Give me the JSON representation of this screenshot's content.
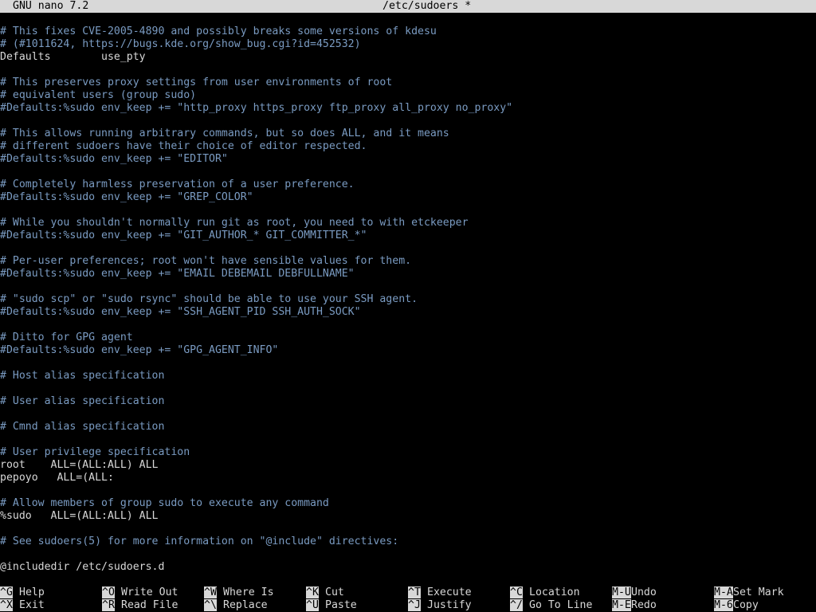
{
  "titlebar": {
    "version": "GNU nano 7.2",
    "filename": "/etc/sudoers *"
  },
  "colors": {
    "background": "#000000",
    "text": "#d8d8d8",
    "comment": "#7a9bc2",
    "inverse_bg": "#d8d8d8"
  },
  "buffer": {
    "lines": [
      {
        "text": "# This fixes CVE-2005-4890 and possibly breaks some versions of kdesu",
        "comment": true
      },
      {
        "text": "# (#1011624, https://bugs.kde.org/show_bug.cgi?id=452532)",
        "comment": true
      },
      {
        "text": "Defaults        use_pty",
        "comment": false
      },
      {
        "text": "",
        "comment": false
      },
      {
        "text": "# This preserves proxy settings from user environments of root",
        "comment": true
      },
      {
        "text": "# equivalent users (group sudo)",
        "comment": true
      },
      {
        "text": "#Defaults:%sudo env_keep += \"http_proxy https_proxy ftp_proxy all_proxy no_proxy\"",
        "comment": true
      },
      {
        "text": "",
        "comment": false
      },
      {
        "text": "# This allows running arbitrary commands, but so does ALL, and it means",
        "comment": true
      },
      {
        "text": "# different sudoers have their choice of editor respected.",
        "comment": true
      },
      {
        "text": "#Defaults:%sudo env_keep += \"EDITOR\"",
        "comment": true
      },
      {
        "text": "",
        "comment": false
      },
      {
        "text": "# Completely harmless preservation of a user preference.",
        "comment": true
      },
      {
        "text": "#Defaults:%sudo env_keep += \"GREP_COLOR\"",
        "comment": true
      },
      {
        "text": "",
        "comment": false
      },
      {
        "text": "# While you shouldn't normally run git as root, you need to with etckeeper",
        "comment": true
      },
      {
        "text": "#Defaults:%sudo env_keep += \"GIT_AUTHOR_* GIT_COMMITTER_*\"",
        "comment": true
      },
      {
        "text": "",
        "comment": false
      },
      {
        "text": "# Per-user preferences; root won't have sensible values for them.",
        "comment": true
      },
      {
        "text": "#Defaults:%sudo env_keep += \"EMAIL DEBEMAIL DEBFULLNAME\"",
        "comment": true
      },
      {
        "text": "",
        "comment": false
      },
      {
        "text": "# \"sudo scp\" or \"sudo rsync\" should be able to use your SSH agent.",
        "comment": true
      },
      {
        "text": "#Defaults:%sudo env_keep += \"SSH_AGENT_PID SSH_AUTH_SOCK\"",
        "comment": true
      },
      {
        "text": "",
        "comment": false
      },
      {
        "text": "# Ditto for GPG agent",
        "comment": true
      },
      {
        "text": "#Defaults:%sudo env_keep += \"GPG_AGENT_INFO\"",
        "comment": true
      },
      {
        "text": "",
        "comment": false
      },
      {
        "text": "# Host alias specification",
        "comment": true
      },
      {
        "text": "",
        "comment": false
      },
      {
        "text": "# User alias specification",
        "comment": true
      },
      {
        "text": "",
        "comment": false
      },
      {
        "text": "# Cmnd alias specification",
        "comment": true
      },
      {
        "text": "",
        "comment": false
      },
      {
        "text": "# User privilege specification",
        "comment": true
      },
      {
        "text": "root    ALL=(ALL:ALL) ALL",
        "comment": false
      },
      {
        "text": "pepoyo   ALL=(ALL:",
        "comment": false
      },
      {
        "text": "",
        "comment": false
      },
      {
        "text": "# Allow members of group sudo to execute any command",
        "comment": true
      },
      {
        "text": "%sudo   ALL=(ALL:ALL) ALL",
        "comment": false
      },
      {
        "text": "",
        "comment": false
      },
      {
        "text": "# See sudoers(5) for more information on \"@include\" directives:",
        "comment": true
      },
      {
        "text": "",
        "comment": false
      },
      {
        "text": "@includedir /etc/sudoers.d",
        "comment": false
      }
    ]
  },
  "shortcuts": [
    {
      "key": "^G",
      "label": "Help",
      "name": "help"
    },
    {
      "key": "^O",
      "label": "Write Out",
      "name": "write-out"
    },
    {
      "key": "^W",
      "label": "Where Is",
      "name": "where-is"
    },
    {
      "key": "^K",
      "label": "Cut",
      "name": "cut"
    },
    {
      "key": "^T",
      "label": "Execute",
      "name": "execute"
    },
    {
      "key": "^C",
      "label": "Location",
      "name": "location"
    },
    {
      "key": "M-U",
      "label": "Undo",
      "name": "undo"
    },
    {
      "key": "M-A",
      "label": "Set Mark",
      "name": "set-mark"
    },
    {
      "key": "^X",
      "label": "Exit",
      "name": "exit"
    },
    {
      "key": "^R",
      "label": "Read File",
      "name": "read-file"
    },
    {
      "key": "^\\",
      "label": "Replace",
      "name": "replace"
    },
    {
      "key": "^U",
      "label": "Paste",
      "name": "paste"
    },
    {
      "key": "^J",
      "label": "Justify",
      "name": "justify"
    },
    {
      "key": "^/",
      "label": "Go To Line",
      "name": "go-to-line"
    },
    {
      "key": "M-E",
      "label": "Redo",
      "name": "redo"
    },
    {
      "key": "M-6",
      "label": "Copy",
      "name": "copy"
    }
  ]
}
